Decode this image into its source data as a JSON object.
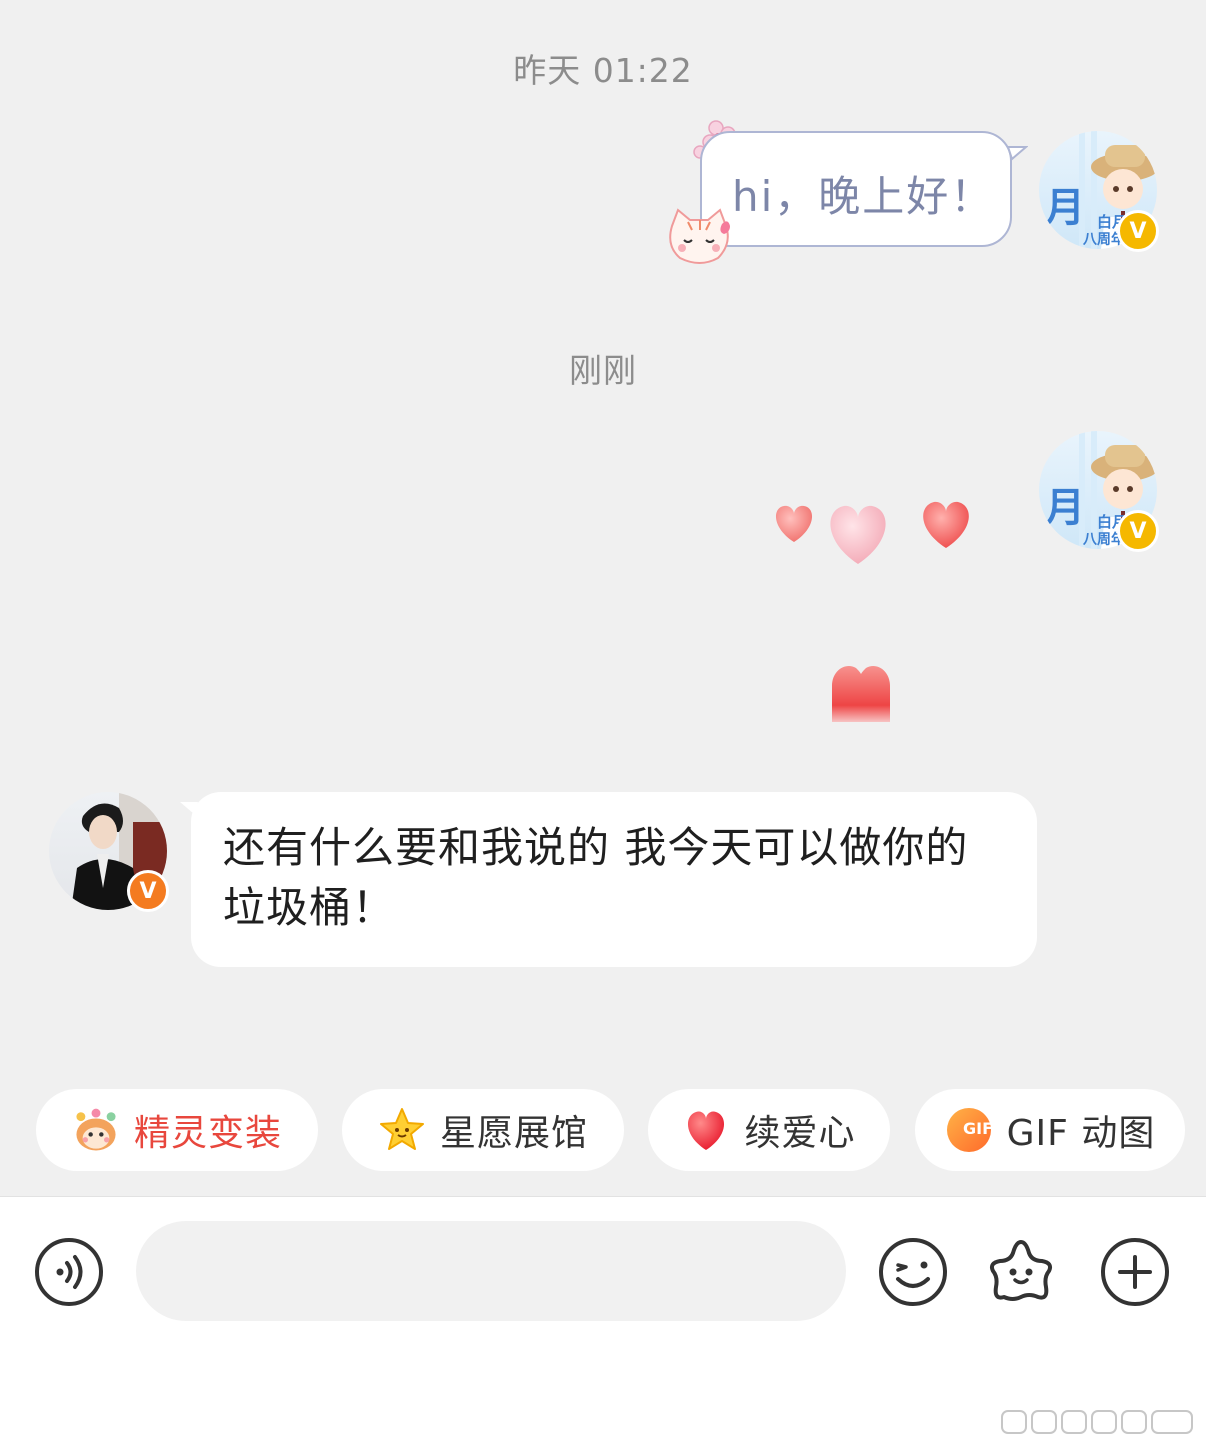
{
  "chat": {
    "timestamp_1": "昨天 01:22",
    "timestamp_2": "刚刚",
    "my_message": "hi，晚上好！",
    "other_message": "还有什么要和我说的  我今天可以做你的垃圾桶！"
  },
  "avatars": {
    "me_text": [
      "月",
      "白月",
      "八周年"
    ],
    "badge_me_color": "#f5b800",
    "badge_other_color": "#f47b20"
  },
  "quick_actions": [
    {
      "label": "精灵变装",
      "icon": "sprite-icon",
      "color": "#e8473d"
    },
    {
      "label": "星愿展馆",
      "icon": "star-icon",
      "color": "#333333"
    },
    {
      "label": "续爱心",
      "icon": "heart-icon",
      "color": "#333333"
    },
    {
      "label": "GIF 动图",
      "icon": "gif-icon",
      "color": "#333333"
    }
  ],
  "input_bar": {
    "placeholder": "",
    "gif_badge": "GIF"
  }
}
